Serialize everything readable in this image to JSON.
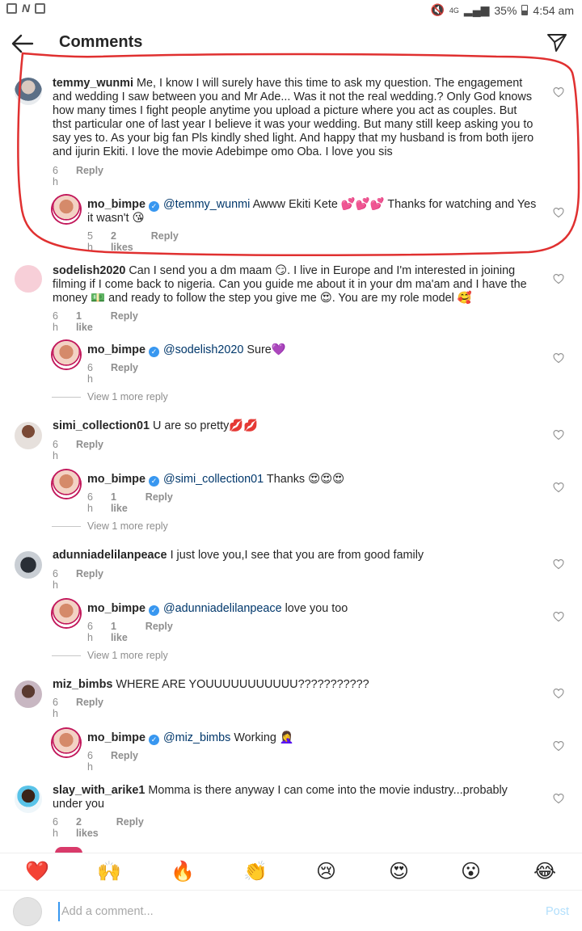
{
  "status_bar": {
    "network": "4G",
    "battery": "35%",
    "time": "4:54 am"
  },
  "header": {
    "title": "Comments"
  },
  "comments": [
    {
      "username": "temmy_wunmi",
      "text": "Me, I know I will surely have this time to ask my question. The engagement and wedding I saw between you and Mr Ade... Was it not the real wedding.? Only God knows how many times I fight people anytime you upload a picture where you act as couples. But thst particular one of last year I believe it was your wedding. But many still keep asking you to say yes to. As your big fan Pls kindly shed light.  And happy that my husband is from both ijero and ijurin Ekiti. I love the movie Adebimpe omo Oba. I love you sis",
      "time": "6 h",
      "reply": "Reply"
    },
    {
      "username": "mo_bimpe",
      "mention": "@temmy_wunmi",
      "text": "Awww Ekiti Kete 💕💕💕 Thanks for watching and Yes it wasn't 😘",
      "time": "5 h",
      "likes": "2 likes",
      "reply": "Reply"
    },
    {
      "username": "sodelish2020",
      "text": "Can I send you a dm maam 😏. I live in Europe and I'm interested in joining filming if I come back to nigeria. Can you guide me about it in your dm ma'am and I have the money 💵 and ready to follow the step you give me 😍. You are my role model 🥰",
      "time": "6 h",
      "likes": "1 like",
      "reply": "Reply"
    },
    {
      "username": "mo_bimpe",
      "mention": "@sodelish2020",
      "text": "Sure💜",
      "time": "6 h",
      "reply": "Reply"
    },
    {
      "view_more": "View 1 more reply"
    },
    {
      "username": "simi_collection01",
      "text": "U are so pretty💋💋",
      "time": "6 h",
      "reply": "Reply"
    },
    {
      "username": "mo_bimpe",
      "mention": "@simi_collection01",
      "text": "Thanks 😍😍😍",
      "time": "6 h",
      "likes": "1 like",
      "reply": "Reply"
    },
    {
      "view_more": "View 1 more reply"
    },
    {
      "username": "adunniadelilanpeace",
      "text": "I just love you,I see that you are from good family",
      "time": "6 h",
      "reply": "Reply"
    },
    {
      "username": "mo_bimpe",
      "mention": "@adunniadelilanpeace",
      "text": "love you too",
      "time": "6 h",
      "likes": "1 like",
      "reply": "Reply"
    },
    {
      "view_more": "View 1 more reply"
    },
    {
      "username": "miz_bimbs",
      "text": "WHERE ARE YOUUUUUUUUUUU???????????",
      "time": "6 h",
      "reply": "Reply"
    },
    {
      "username": "mo_bimpe",
      "mention": "@miz_bimbs",
      "text": "Working 🤦‍♀️",
      "time": "6 h",
      "reply": "Reply"
    },
    {
      "username": "slay_with_arike1",
      "text": "Momma is there anyway I can come into the movie industry...probably under you",
      "time": "6 h",
      "likes": "2 likes",
      "reply": "Reply"
    }
  ],
  "emoji_bar": [
    "❤️",
    "🙌",
    "🔥",
    "👏",
    "😢",
    "😍",
    "😮",
    "😂"
  ],
  "composer": {
    "placeholder": "Add a comment...",
    "post_label": "Post"
  },
  "colors": {
    "annotation_circle": "#e03030",
    "verified": "#3897f0",
    "mention": "#00376b",
    "post_disabled": "#b2dffc"
  }
}
